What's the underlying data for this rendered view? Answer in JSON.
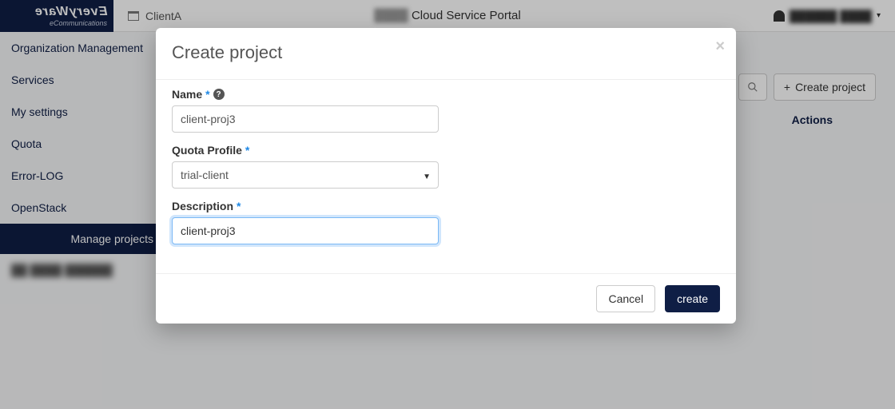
{
  "logo": {
    "line1": "EveryWare",
    "line2": "eCommunications"
  },
  "topbar": {
    "client": "ClientA",
    "portal_title_blur": "████",
    "portal_title": "Cloud Service Portal",
    "user_caret": "▾"
  },
  "sidebar": {
    "items": [
      {
        "label": "Organization Management"
      },
      {
        "label": "Services"
      },
      {
        "label": "My settings"
      },
      {
        "label": "Quota"
      },
      {
        "label": "Error-LOG"
      },
      {
        "label": "OpenStack"
      }
    ],
    "sub": {
      "label": "Manage projects"
    }
  },
  "main": {
    "create_btn": "Create project",
    "table": {
      "actions_header": "Actions"
    }
  },
  "modal": {
    "title": "Create project",
    "fields": {
      "name_label": "Name",
      "name_value": "client-proj3",
      "quota_label": "Quota Profile",
      "quota_value": "trial-client",
      "desc_label": "Description",
      "desc_value": "client-proj3"
    },
    "required": "*",
    "help": "?",
    "buttons": {
      "cancel": "Cancel",
      "create": "create"
    }
  }
}
